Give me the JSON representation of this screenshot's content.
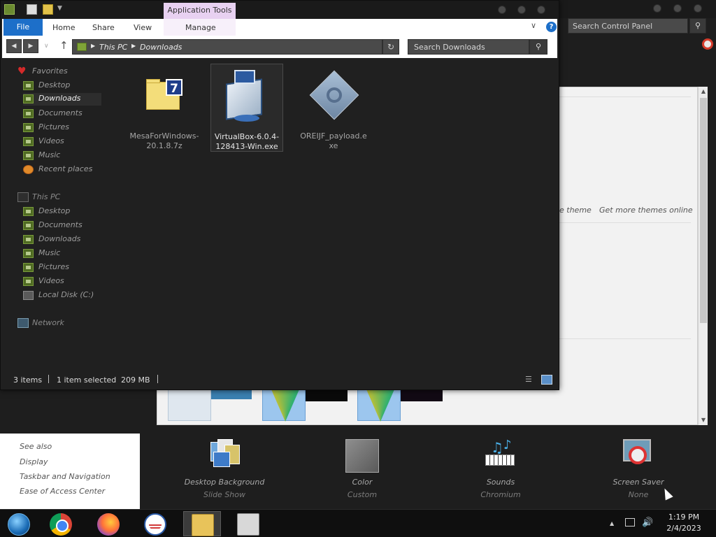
{
  "explorer": {
    "app_tools_tab": "Application Tools",
    "ribbon_tabs": {
      "file": "File",
      "home": "Home",
      "share": "Share",
      "view": "View",
      "manage": "Manage"
    },
    "help_glyph": "?",
    "address": {
      "crumbs": [
        "This PC",
        "Downloads"
      ]
    },
    "search_placeholder": "Search Downloads",
    "nav": {
      "favorites_label": "Favorites",
      "favorites": [
        "Desktop",
        "Downloads",
        "Documents",
        "Pictures",
        "Videos",
        "Music",
        "Recent places"
      ],
      "selected": "Downloads",
      "this_pc_label": "This PC",
      "this_pc": [
        "Desktop",
        "Documents",
        "Downloads",
        "Music",
        "Pictures",
        "Videos",
        "Local Disk (C:)"
      ],
      "network_label": "Network"
    },
    "files": [
      {
        "name": "MesaForWindows-20.1.8.7z",
        "icon": "7zip-archive-icon",
        "selected": false
      },
      {
        "name": "VirtualBox-6.0.4-128413-Win.exe",
        "icon": "virtualbox-installer-icon",
        "selected": true
      },
      {
        "name": "OREIJF_payload.exe",
        "icon": "generic-exe-icon",
        "selected": false
      }
    ],
    "status": {
      "items": "3 items",
      "selected": "1 item selected",
      "size": "209 MB"
    }
  },
  "control_panel": {
    "search_placeholder": "Search Control Panel",
    "save_theme": "e theme",
    "get_more_themes": "Get more themes online",
    "see_also_label": "See also",
    "see_also_links": [
      "Display",
      "Taskbar and Navigation",
      "Ease of Access Center"
    ],
    "bottom_items": [
      {
        "label": "Desktop Background",
        "sub": "Slide Show",
        "icon": "desktop-background-icon"
      },
      {
        "label": "Color",
        "sub": "Custom",
        "icon": "color-icon"
      },
      {
        "label": "Sounds",
        "sub": "Chromium",
        "icon": "sounds-icon"
      },
      {
        "label": "Screen Saver",
        "sub": "None",
        "icon": "screen-saver-icon"
      }
    ]
  },
  "taskbar": {
    "apps": [
      "start-orb-icon",
      "chrome-icon",
      "firefox-icon",
      "obama-logo-icon",
      "file-explorer-icon",
      "store-icon"
    ],
    "clock_time": "1:19 PM",
    "clock_date": "2/4/2023"
  },
  "colors": {
    "file_tab": "#1d6fc9",
    "application_tools": "#e8d1f1",
    "window_bg": "#202020",
    "taskbar_bg": "#0f0f0f"
  }
}
